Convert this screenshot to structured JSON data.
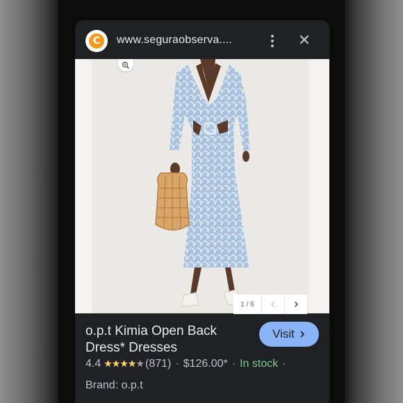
{
  "browser": {
    "url": "www.seguraobserva....",
    "favicon_letter": "C"
  },
  "gallery": {
    "counter": "1 / 6"
  },
  "product": {
    "title": "o.p.t Kimia Open Back Dress* Dresses",
    "rating": "4.4",
    "stars": 4.4,
    "reviews": "(871)",
    "price": "$126.00*",
    "availability": "In stock",
    "brand": "Brand: o.p.t"
  },
  "actions": {
    "visit_label": "Visit"
  },
  "colors": {
    "card_bg": "#202124",
    "accent": "#8ab4f8",
    "in_stock": "#81c995",
    "star": "#fdd663",
    "favicon": "#f29a1f"
  }
}
